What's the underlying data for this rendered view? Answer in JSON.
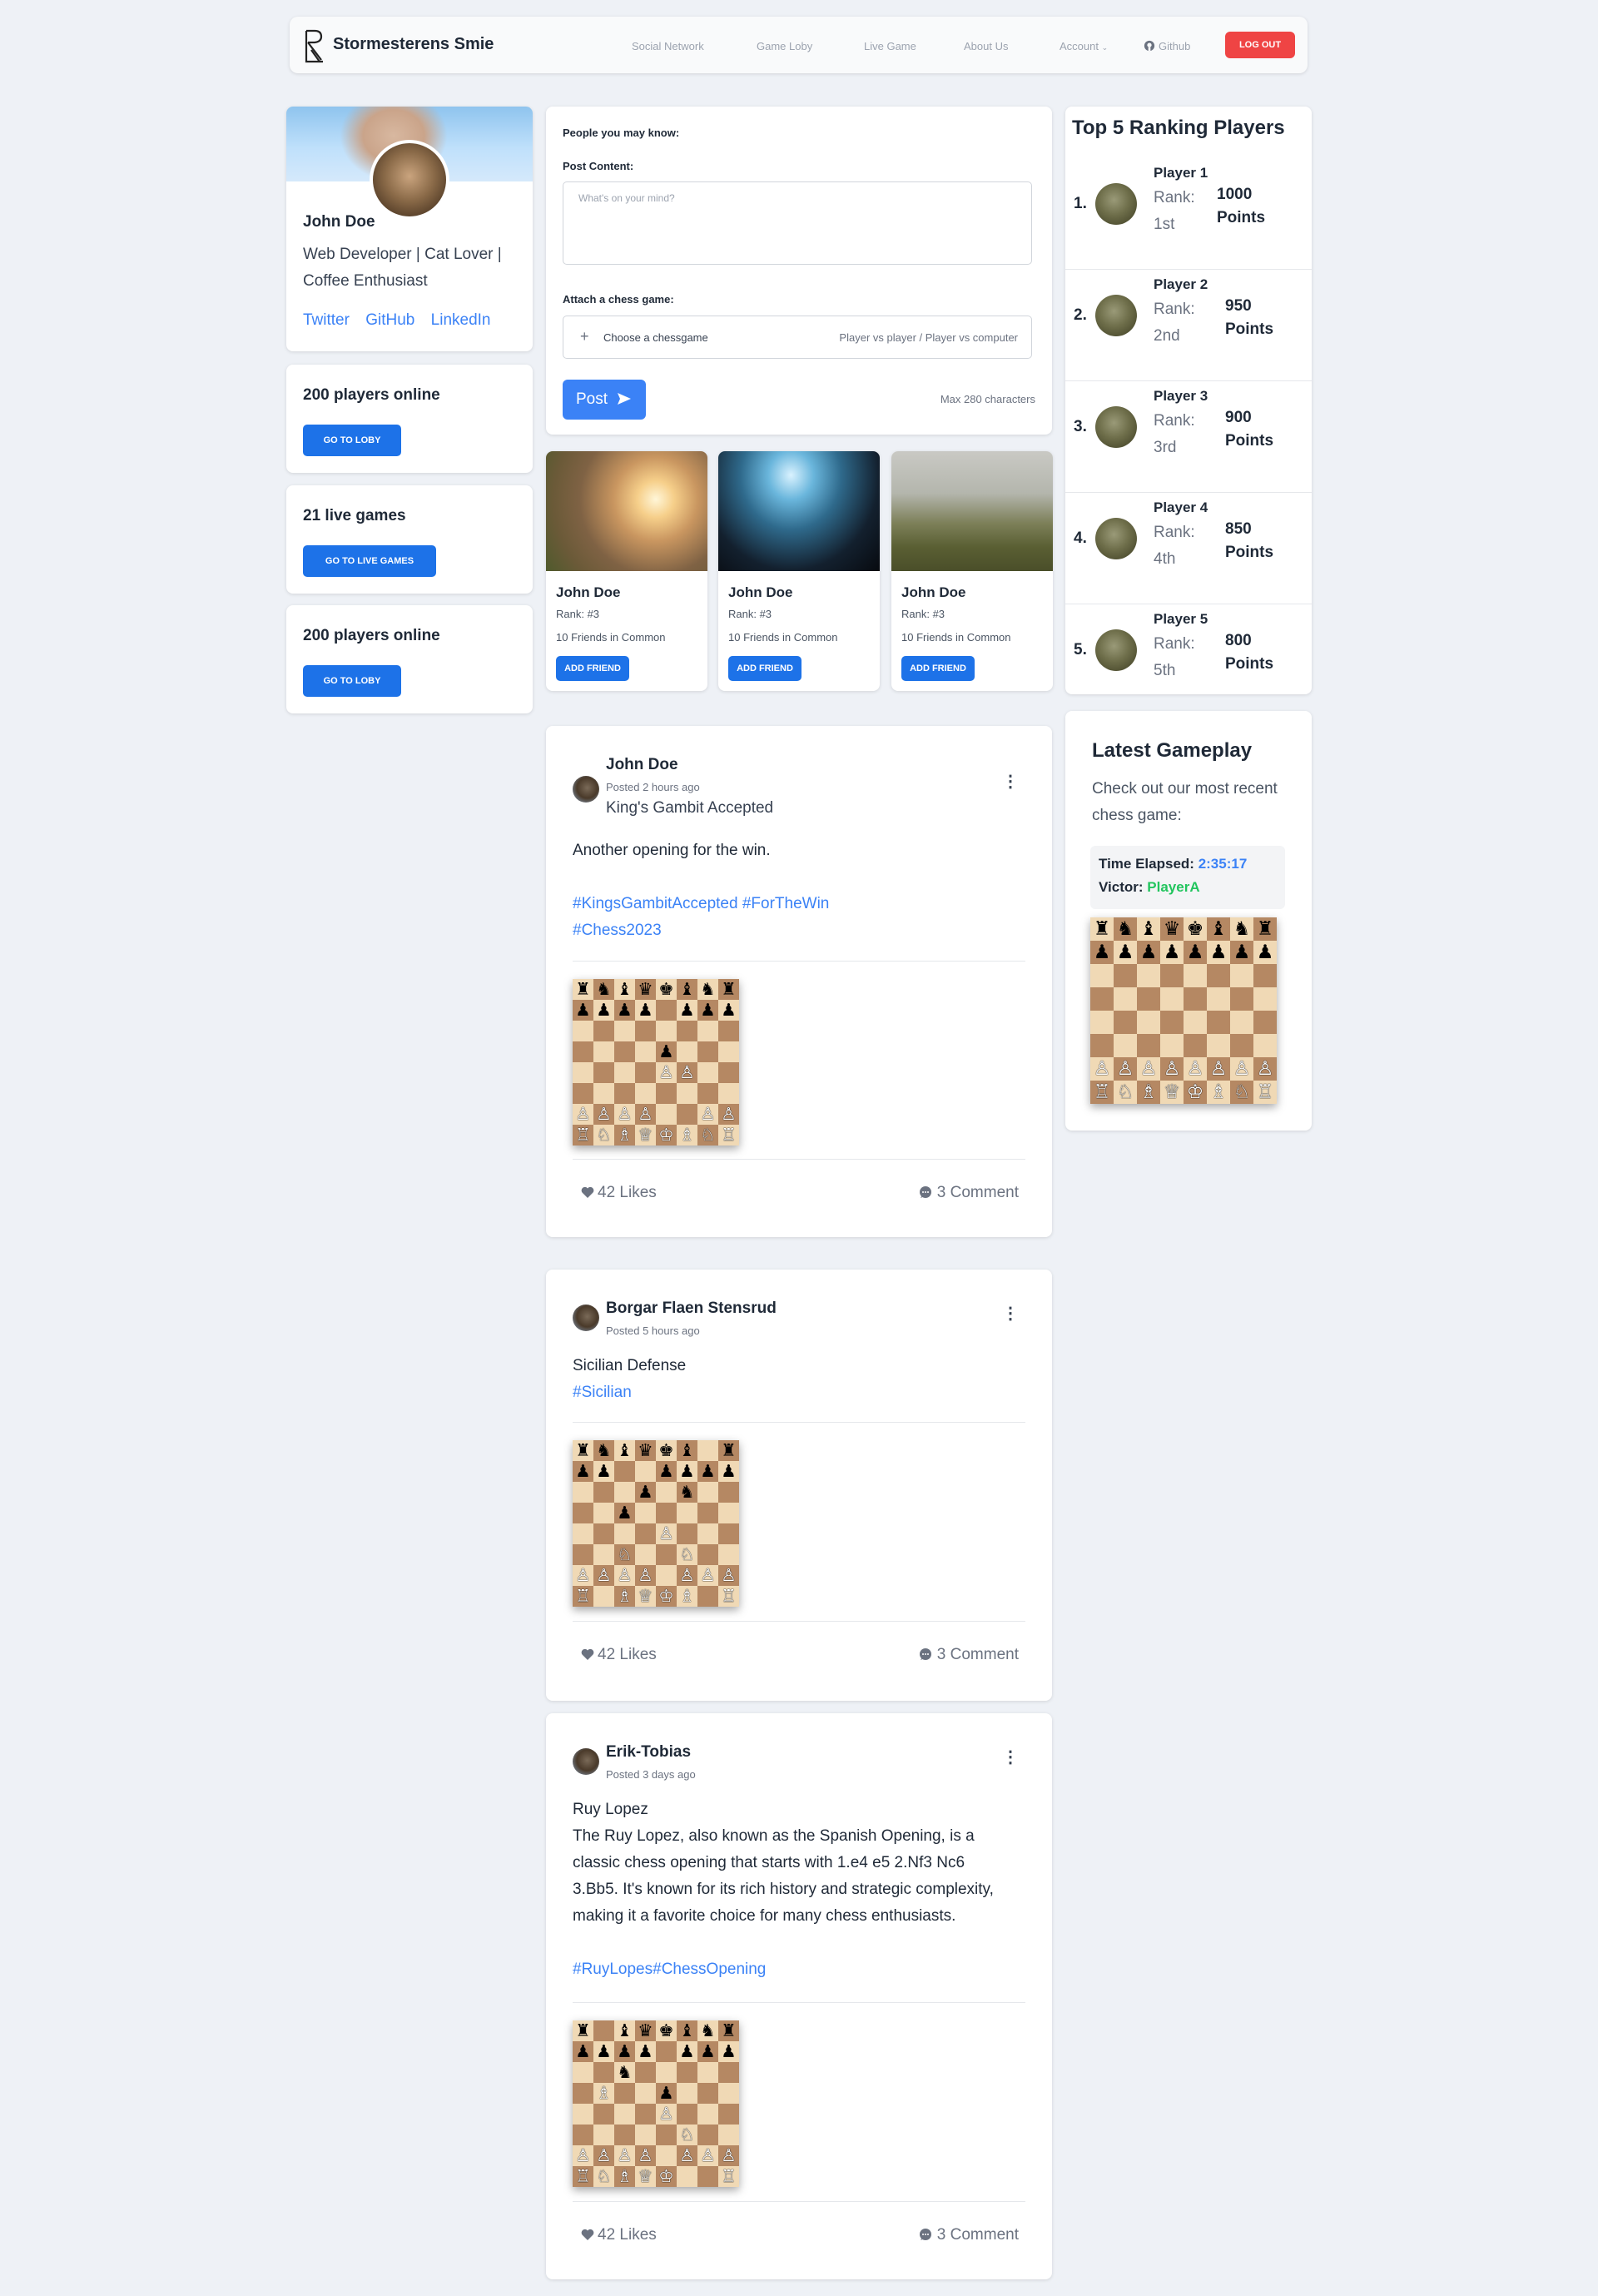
{
  "nav": {
    "brand": "Stormesterens Smie",
    "links": [
      "Social Network",
      "Game Loby",
      "Live Game",
      "About Us"
    ],
    "account": "Account",
    "github": "Github",
    "logout": "LOG OUT"
  },
  "profile": {
    "name": "John Doe",
    "bio": "Web Developer | Cat Lover | Coffee Enthusiast",
    "links": [
      "Twitter",
      "GitHub",
      "LinkedIn"
    ]
  },
  "stats": [
    {
      "title": "200 players online",
      "button": "GO TO LOBY"
    },
    {
      "title": "21 live games",
      "button": "GO TO LIVE GAMES"
    },
    {
      "title": "200 players online",
      "button": "GO TO LOBY"
    }
  ],
  "compose": {
    "people_label": "People you may know:",
    "content_label": "Post Content:",
    "placeholder": "What's on your mind?",
    "attach_label": "Attach a chess game:",
    "choose": "Choose a chessgame",
    "modes": "Player vs player / Player vs computer",
    "post_button": "Post",
    "max_chars": "Max 280 characters"
  },
  "friends": [
    {
      "name": "John Doe",
      "rank": "Rank: #3",
      "common": "10 Friends in Common",
      "button": "ADD FRIEND"
    },
    {
      "name": "John Doe",
      "rank": "Rank: #3",
      "common": "10 Friends in Common",
      "button": "ADD FRIEND"
    },
    {
      "name": "John Doe",
      "rank": "Rank: #3",
      "common": "10 Friends in Common",
      "button": "ADD FRIEND"
    }
  ],
  "ranking": {
    "title": "Top 5 Ranking Players",
    "players": [
      {
        "num": "1.",
        "name": "Player 1",
        "rank": "Rank: 1st",
        "points": "1000 Points"
      },
      {
        "num": "2.",
        "name": "Player 2",
        "rank": "Rank: 2nd",
        "points": "950 Points"
      },
      {
        "num": "3.",
        "name": "Player 3",
        "rank": "Rank: 3rd",
        "points": "900 Points"
      },
      {
        "num": "4.",
        "name": "Player 4",
        "rank": "Rank: 4th",
        "points": "850 Points"
      },
      {
        "num": "5.",
        "name": "Player 5",
        "rank": "Rank: 5th",
        "points": "800 Points"
      }
    ]
  },
  "latest": {
    "title": "Latest Gameplay",
    "desc": "Check out our most recent chess game:",
    "time_label": "Time Elapsed:",
    "time_value": "2:35:17",
    "victor_label": "Victor:",
    "victor_value": "PlayerA",
    "board": [
      "rnbqkbnr",
      "pppppppp",
      "........",
      "........",
      "........",
      "........",
      "PPPPPPPP",
      "RNBQKBNR"
    ]
  },
  "posts": [
    {
      "author": "John Doe",
      "time": "Posted 2 hours ago",
      "subtitle": "King's Gambit Accepted",
      "body": "Another opening for the win.",
      "tags": "#KingsGambitAccepted  #ForTheWin #Chess2023",
      "likes": "42 Likes",
      "comments": "3 Comment",
      "board": [
        "rnbqkbnr",
        "pppp.ppp",
        "........",
        "....p...",
        "....PP..",
        "........",
        "PPPP..PP",
        "RNBQKBNR"
      ]
    },
    {
      "author": "Borgar Flaen Stensrud",
      "time": "Posted 5 hours ago",
      "title": "Sicilian Defense",
      "tags": "#Sicilian",
      "likes": "42 Likes",
      "comments": "3 Comment",
      "board": [
        "rnbqkb.r",
        "pp..pppp",
        "...p.n..",
        "..p.....",
        "....P...",
        "..N..N..",
        "PPPP.PPP",
        "R.BQKB.R"
      ]
    },
    {
      "author": "Erik-Tobias",
      "time": "Posted 3 days ago",
      "title": "Ruy Lopez",
      "body": "The Ruy Lopez, also known as the Spanish Opening, is a classic chess opening that starts with 1.e4 e5 2.Nf3 Nc6 3.Bb5. It's known for its rich history and strategic complexity, making it a favorite choice for many chess enthusiasts.",
      "tags": "#RuyLopes#ChessOpening",
      "likes": "42 Likes",
      "comments": "3 Comment",
      "board": [
        "r.bqkbnr",
        "pppp.ppp",
        "..n.....",
        ".B..p...",
        "....P...",
        ".....N..",
        "PPPP.PPP",
        "RNBQK..R"
      ]
    }
  ]
}
